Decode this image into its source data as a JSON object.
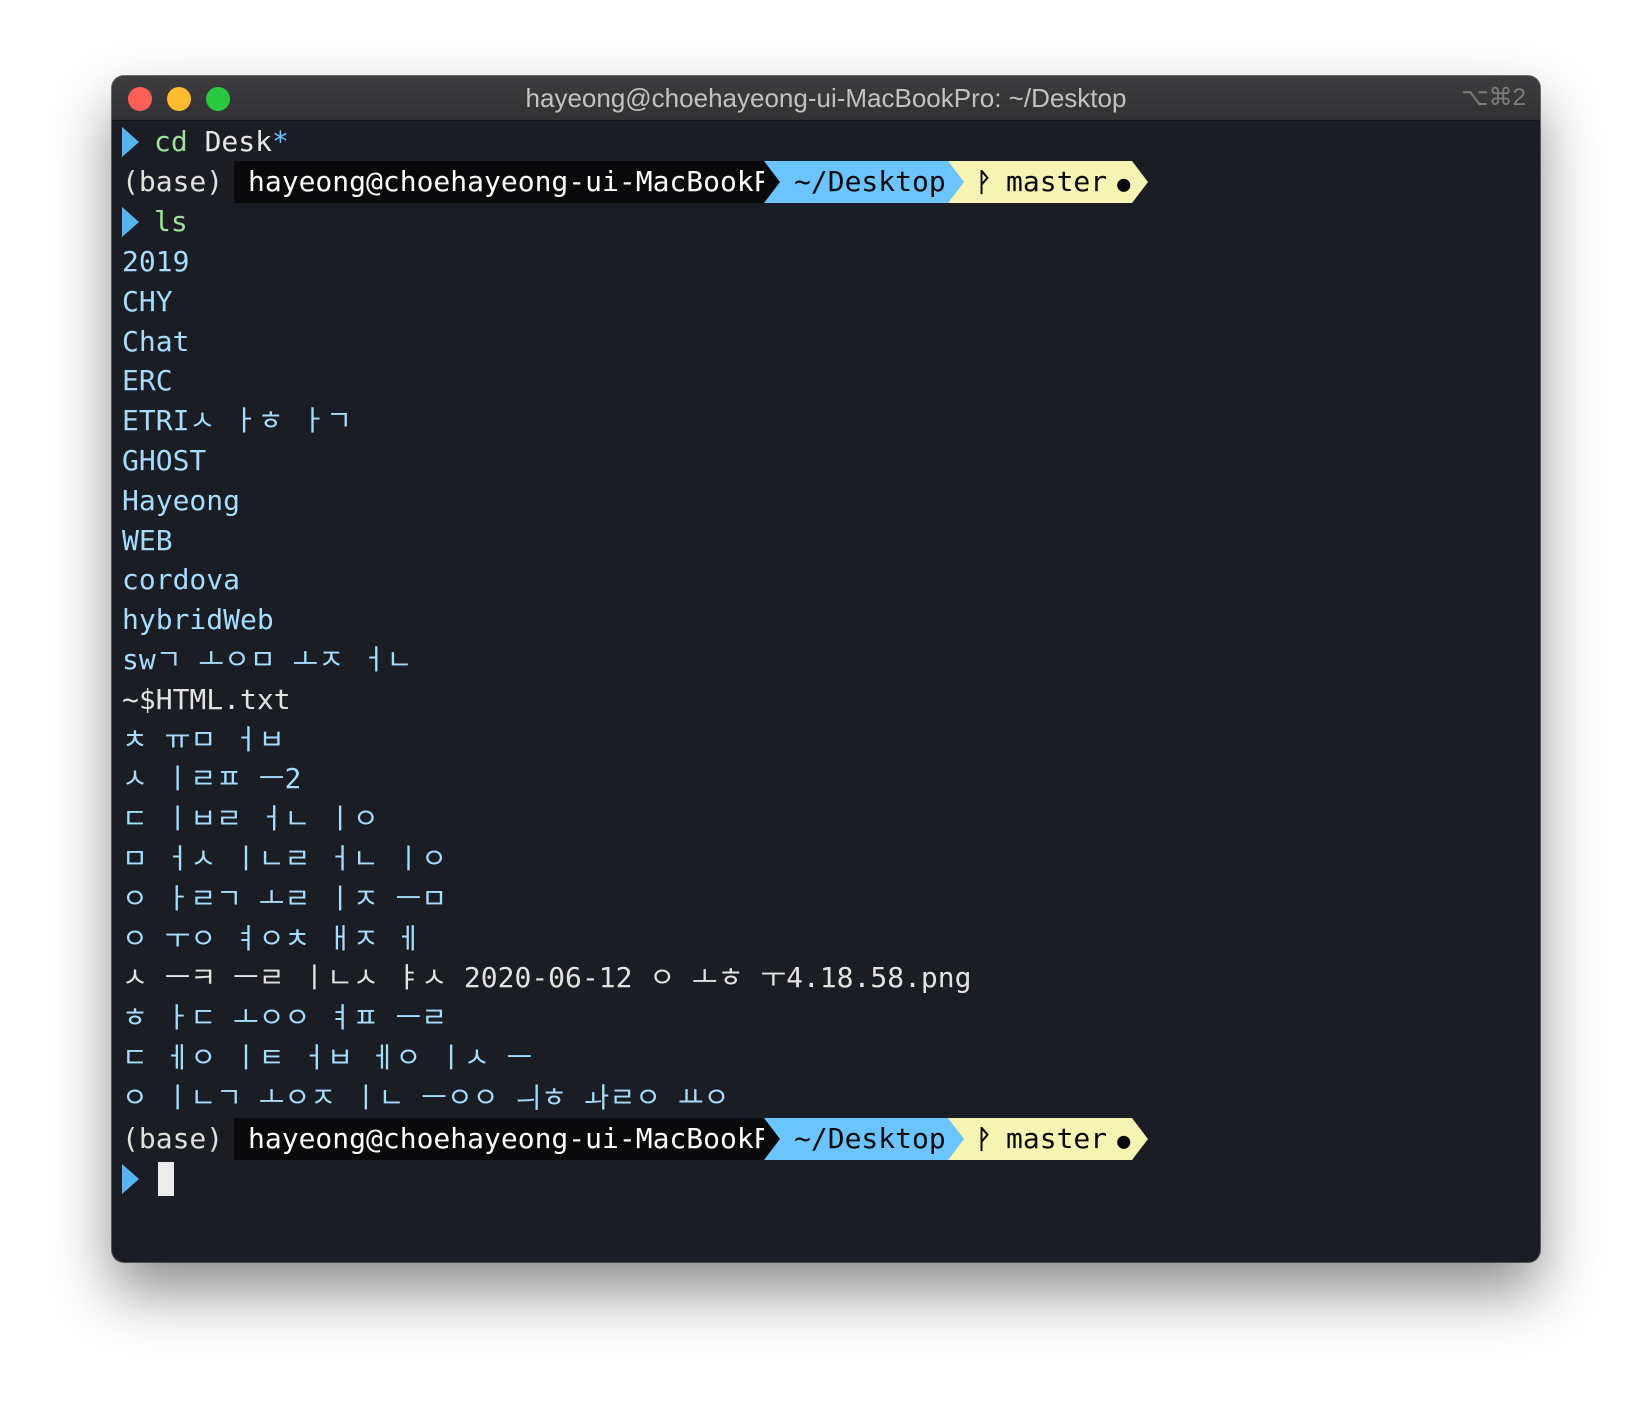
{
  "window": {
    "title": "hayeong@choehayeong-ui-MacBookPro: ~/Desktop",
    "shortcut": "⌥⌘2"
  },
  "colors": {
    "background": "#1b1d24",
    "dir_segment": "#6cc4ff",
    "git_segment": "#f5f4b3",
    "prompt_chevron": "#57b4f2",
    "directory_entry": "#a4ddff",
    "command_word": "#9de29a"
  },
  "icons": {
    "prompt": "chevron-right-icon",
    "branch": "git-branch-icon",
    "dirty": "dot-icon"
  },
  "session": {
    "first_command": {
      "keyword": "cd",
      "argument": "Desk",
      "glob": "*"
    },
    "prompt": {
      "env": "(base)",
      "user_host": "hayeong@choehayeong-ui-MacBookPro",
      "dir": "~/Desktop",
      "branch": "master",
      "dirty_mark": "●",
      "branch_glyph": "ᚹ"
    },
    "second_command": {
      "keyword": "ls"
    },
    "listing": [
      {
        "name": "2019",
        "is_dir": true
      },
      {
        "name": "CHY",
        "is_dir": true
      },
      {
        "name": "Chat",
        "is_dir": true
      },
      {
        "name": "ERC",
        "is_dir": true
      },
      {
        "name": "ETRIㅅ ㅏㅎ ㅏㄱ",
        "is_dir": true
      },
      {
        "name": "GHOST",
        "is_dir": true
      },
      {
        "name": "Hayeong",
        "is_dir": true
      },
      {
        "name": "WEB",
        "is_dir": true
      },
      {
        "name": "cordova",
        "is_dir": true
      },
      {
        "name": "hybridWeb",
        "is_dir": true
      },
      {
        "name": "swㄱ ㅗㅇㅁ ㅗㅈ ㅓㄴ",
        "is_dir": true
      },
      {
        "name": "~$HTML.txt",
        "is_dir": false
      },
      {
        "name": "ㅊ ㅠㅁ ㅓㅂ",
        "is_dir": true
      },
      {
        "name": "ㅅ ㅣㄹㅍ ㅡ2",
        "is_dir": true
      },
      {
        "name": "ㄷ ㅣㅂㄹ ㅓㄴ ㅣㅇ",
        "is_dir": true
      },
      {
        "name": "ㅁ ㅓㅅ ㅣㄴㄹ ㅓㄴ ㅣㅇ",
        "is_dir": true
      },
      {
        "name": "ㅇ ㅏㄹㄱ ㅗㄹ ㅣㅈ ㅡㅁ",
        "is_dir": true
      },
      {
        "name": "ㅇ ㅜㅇ ㅕㅇㅊ ㅐㅈ ㅔ",
        "is_dir": true
      },
      {
        "name": "ㅅ ㅡㅋ ㅡㄹ ㅣㄴㅅ ㅑㅅ 2020-06-12 ㅇ ㅗㅎ ㅜ4.18.58.png",
        "is_dir": false,
        "mixed": true
      },
      {
        "name": "ㅎ ㅏㄷ ㅗㅇㅇ ㅕㅍ ㅡㄹ",
        "is_dir": true
      },
      {
        "name": "ㄷ ㅔㅇ ㅣㅌ ㅓㅂ ㅔㅇ ㅣㅅ ㅡ",
        "is_dir": true
      },
      {
        "name": "ㅇ ㅣㄴㄱ ㅗㅇㅈ ㅣㄴ ㅡㅇㅇ ㅢㅎ ㅘㄹㅇ ㅛㅇ",
        "is_dir": true
      }
    ]
  }
}
